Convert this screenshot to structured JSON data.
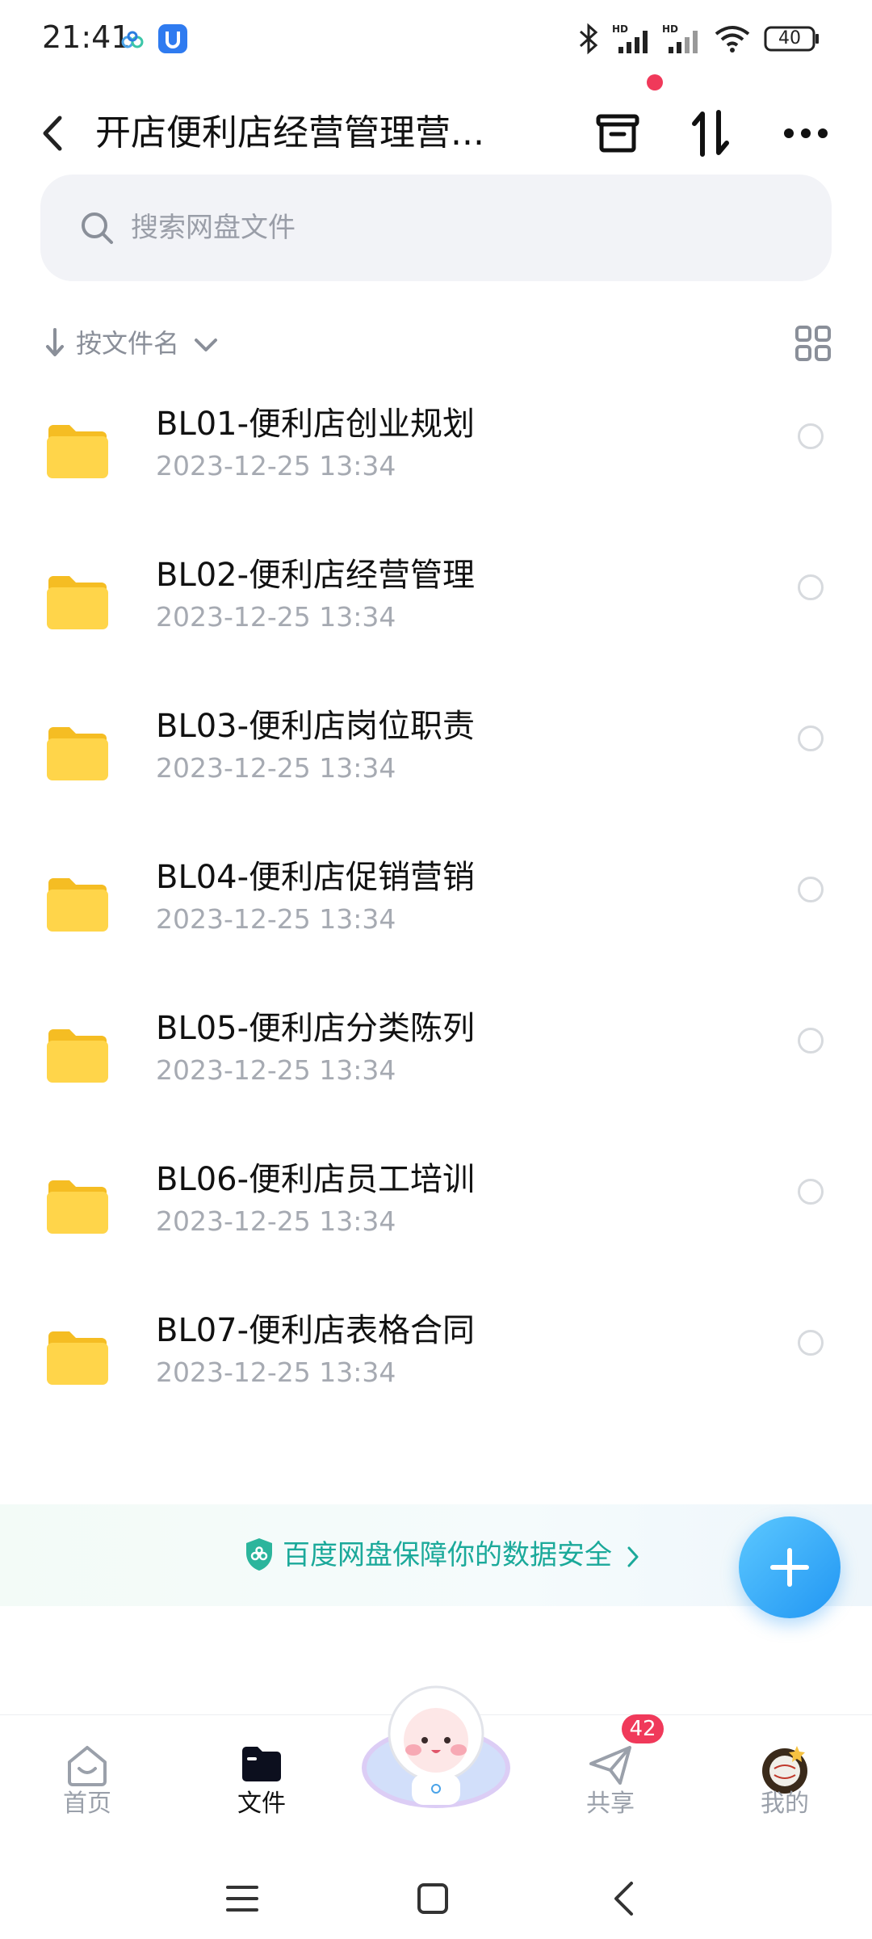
{
  "status_bar": {
    "time": "21:41",
    "battery": "40",
    "icons": [
      "baidu-cloud-icon",
      "app-shield-icon",
      "bluetooth-icon",
      "signal-hd-icon",
      "signal-hd-icon",
      "wifi-icon",
      "battery-icon"
    ]
  },
  "header": {
    "title": "开店便利店经营管理营...",
    "back_icon": "chevron-left-icon",
    "archive_icon": "archive-icon",
    "transfer_icon": "transfer-icon",
    "more_icon": "more-icon"
  },
  "search": {
    "placeholder": "搜索网盘文件"
  },
  "sort": {
    "label": "按文件名"
  },
  "files": [
    {
      "name": "BL01-便利店创业规划",
      "date": "2023-12-25  13:34"
    },
    {
      "name": "BL02-便利店经营管理",
      "date": "2023-12-25  13:34"
    },
    {
      "name": "BL03-便利店岗位职责",
      "date": "2023-12-25  13:34"
    },
    {
      "name": "BL04-便利店促销营销",
      "date": "2023-12-25  13:34"
    },
    {
      "name": "BL05-便利店分类陈列",
      "date": "2023-12-25  13:34"
    },
    {
      "name": "BL06-便利店员工培训",
      "date": "2023-12-25  13:34"
    },
    {
      "name": "BL07-便利店表格合同",
      "date": "2023-12-25  13:34"
    }
  ],
  "banner": {
    "text": "百度网盘保障你的数据安全"
  },
  "tabs": [
    {
      "label": "首页"
    },
    {
      "label": "文件"
    },
    {
      "label": "共享"
    },
    {
      "label": "我的"
    }
  ],
  "share_badge": "42",
  "colors": {
    "accent": "#2196f3",
    "folder": "#ffd54a",
    "badge": "#f0395a",
    "banner_text": "#1ba99a"
  }
}
